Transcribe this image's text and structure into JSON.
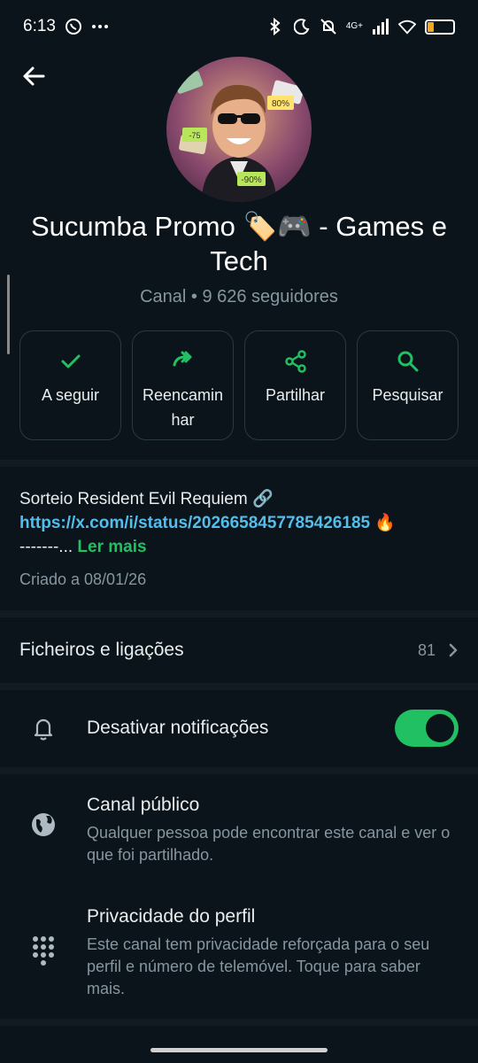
{
  "status_bar": {
    "time": "6:13",
    "left_icons": [
      "whatsapp-icon",
      "more-dots-icon"
    ],
    "right_icons": [
      "bluetooth-icon",
      "moon-icon",
      "silent-icon",
      "signal-icon",
      "wifi-icon",
      "battery-icon"
    ],
    "network": "4G+",
    "battery": "25",
    "battery_color": "#f5a623"
  },
  "header": {
    "back_icon": "arrow-left-icon",
    "title": "Sucumba Promo 🏷️🎮  - Games e Tech",
    "meta": "Canal • 9 626 seguidores",
    "avatar_badges": [
      "80%",
      "-75",
      "-90%"
    ]
  },
  "actions": [
    {
      "label": "A seguir",
      "icon": "check-icon"
    },
    {
      "label": "Reencaminhar",
      "icon": "forward-icon"
    },
    {
      "label": "Partilhar",
      "icon": "share-icon"
    },
    {
      "label": "Pesquisar",
      "icon": "search-icon"
    }
  ],
  "description": {
    "line1": "Sorteio Resident Evil Requiem 🔗",
    "link": "https://x.com/i/status/2026658457785426185",
    "link_suffix": " 🔥",
    "line3": "-------...",
    "read_more": "Ler mais",
    "created": "Criado a 08/01/26"
  },
  "files": {
    "label": "Ficheiros e ligações",
    "count": "81"
  },
  "notifications": {
    "label": "Desativar notificações",
    "enabled": true
  },
  "public_channel": {
    "title": "Canal público",
    "subtitle": "Qualquer pessoa pode encontrar este canal e ver o que foi partilhado."
  },
  "profile_privacy": {
    "title": "Privacidade do perfil",
    "subtitle": "Este canal tem privacidade reforçada para o seu perfil e número de telemóvel. Toque para saber mais."
  },
  "colors": {
    "background": "#0b141a",
    "accent": "#21c063",
    "link": "#53bdeb",
    "muted": "#8696a0"
  }
}
